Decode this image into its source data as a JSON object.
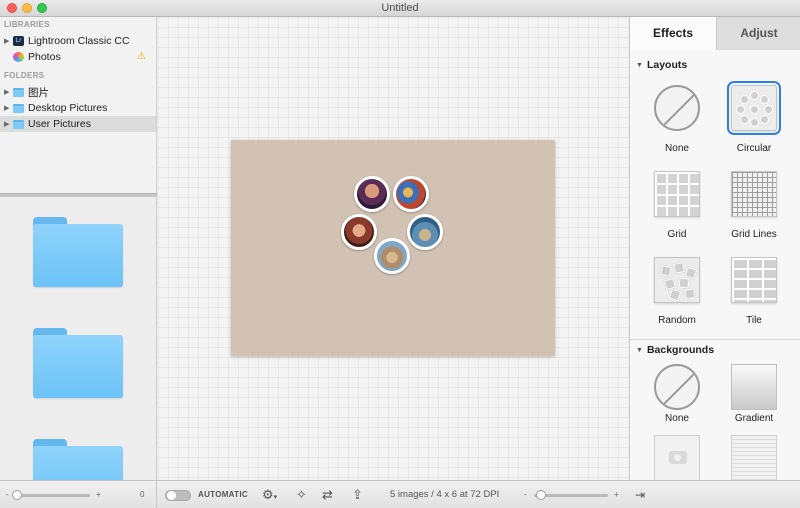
{
  "window": {
    "title": "Untitled"
  },
  "sidebar": {
    "libraries_header": "LIBRARIES",
    "libraries": [
      {
        "label": "Lightroom Classic CC",
        "icon": "lightroom-icon",
        "icon_text": "Lr"
      },
      {
        "label": "Photos",
        "icon": "photos-icon",
        "warning": "⚠"
      }
    ],
    "folders_header": "FOLDERS",
    "folders": [
      {
        "label": "图片"
      },
      {
        "label": "Desktop Pictures"
      },
      {
        "label": "User Pictures",
        "selected": true
      }
    ]
  },
  "canvas": {
    "background": "#d1c2b4",
    "photo_count": 5
  },
  "panel": {
    "tabs": [
      {
        "label": "Effects",
        "active": true
      },
      {
        "label": "Adjust"
      }
    ],
    "layouts_header": "Layouts",
    "layouts": [
      {
        "label": "None"
      },
      {
        "label": "Circular",
        "selected": true
      },
      {
        "label": "Grid"
      },
      {
        "label": "Grid Lines"
      },
      {
        "label": "Random"
      },
      {
        "label": "Tile"
      }
    ],
    "backgrounds_header": "Backgrounds",
    "backgrounds": [
      {
        "label": "None"
      },
      {
        "label": "Gradient"
      }
    ],
    "accent": "#2d7fe3"
  },
  "bottom": {
    "left_slider_value": "0",
    "minus": "-",
    "plus": "+",
    "automatic_label": "AUTOMATIC",
    "status": "5 images / 4 x 6 at 72 DPI"
  }
}
